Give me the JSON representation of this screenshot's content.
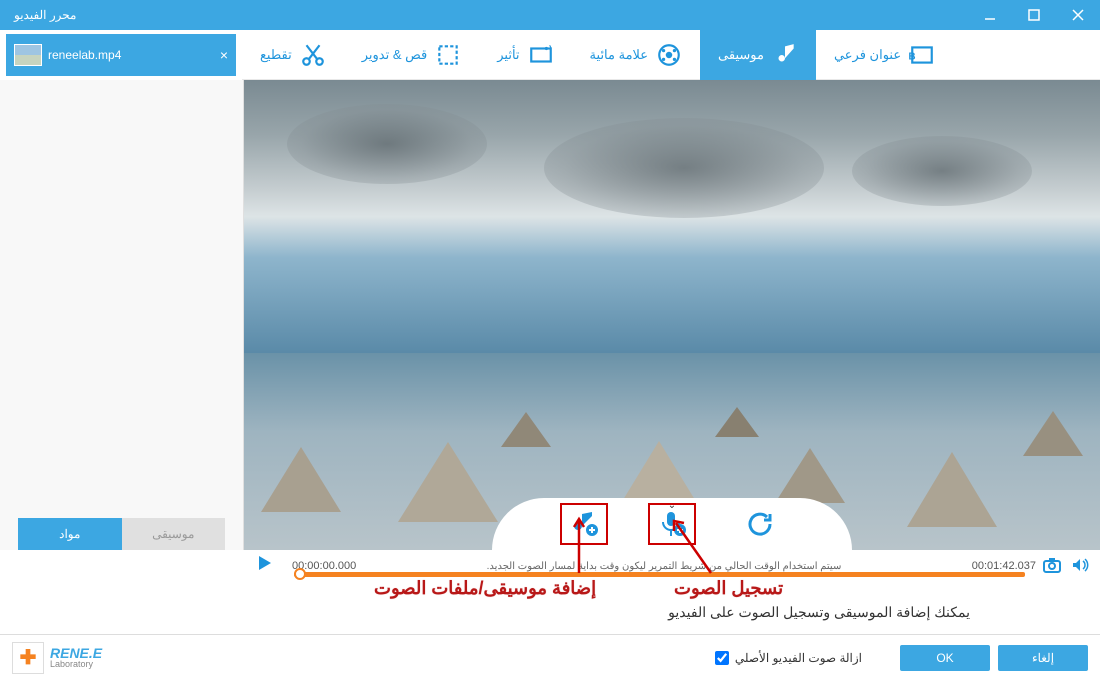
{
  "window": {
    "title": "محرر الفيديو"
  },
  "file_tab": {
    "name": "reneelab.mp4"
  },
  "toolbar": {
    "cut": "تقطيع",
    "crop_rotate": "قص & تدوير",
    "effect": "تأثير",
    "watermark": "علامة مائية",
    "music": "موسيقى",
    "subtitle": "عنوان فرعي"
  },
  "sidebar": {
    "materials": "مواد",
    "music": "موسيقى"
  },
  "actions": {
    "add_music_icon": "add-music",
    "record_audio_icon": "record-audio",
    "refresh_icon": "refresh"
  },
  "timeline": {
    "start": "00:00:00.000",
    "end": "00:01:42.037",
    "hint": "سيتم استخدام الوقت الحالي من شريط التمرير ليكون وقت بداية لمسار الصوت الجديد."
  },
  "annotations": {
    "add_music": "إضافة موسيقى/ملفات الصوت",
    "record_audio": "تسجيل الصوت",
    "description": "يمكنك إضافة الموسيقى وتسجيل الصوت على الفيديو"
  },
  "footer": {
    "logo_top": "RENE.E",
    "logo_bottom": "Laboratory",
    "remove_original_audio": "ازالة صوت الفيديو الأصلي",
    "ok": "OK",
    "cancel": "إلغاء"
  }
}
